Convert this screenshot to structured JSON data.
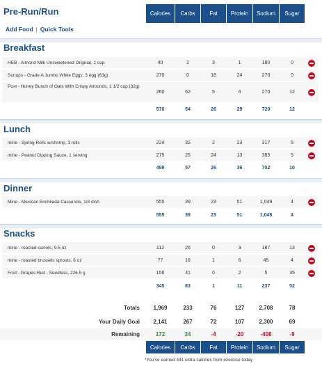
{
  "columns": [
    "Calories",
    "Carbs",
    "Fat",
    "Protein",
    "Sodium",
    "Sugar"
  ],
  "links": {
    "add_food": "Add Food",
    "quick_tools": "Quick Tools",
    "separator": "|"
  },
  "meals": [
    {
      "name": "Pre-Run/Run",
      "items": [],
      "totals": []
    },
    {
      "name": "Breakfast",
      "items": [
        {
          "name": "HEB - Almond Milk Unsweetened Original, 1 cup",
          "values": [
            "40",
            "2",
            "3",
            "1",
            "180",
            "0"
          ]
        },
        {
          "name": "Sunups - Grade A Jumbo White Eggs, 3 egg (63g)",
          "values": [
            "270",
            "0",
            "18",
            "24",
            "270",
            "0"
          ]
        },
        {
          "name": "Post - Honey Bunch of Oats With Crispy Almonds, 1 1/2 cup (32g)",
          "values": [
            "260",
            "52",
            "5",
            "4",
            "270",
            "12"
          ]
        }
      ],
      "totals": [
        "570",
        "54",
        "26",
        "29",
        "720",
        "12"
      ]
    },
    {
      "name": "Lunch",
      "items": [
        {
          "name": "mine - Spring Rolls w/shrimp, 3 rolls",
          "values": [
            "224",
            "32",
            "2",
            "23",
            "317",
            "5"
          ]
        },
        {
          "name": "mine - Peanut Dipping Sauce, 1 serving",
          "values": [
            "275",
            "25",
            "24",
            "13",
            "385",
            "5"
          ]
        }
      ],
      "totals": [
        "499",
        "57",
        "26",
        "36",
        "702",
        "10"
      ]
    },
    {
      "name": "Dinner",
      "items": [
        {
          "name": "Mine - Mexican Enchilada Casserole, 1/8 dish",
          "values": [
            "555",
            "39",
            "23",
            "51",
            "1,049",
            "4"
          ]
        }
      ],
      "totals": [
        "555",
        "39",
        "23",
        "51",
        "1,049",
        "4"
      ]
    },
    {
      "name": "Snacks",
      "items": [
        {
          "name": "mine - roasted carrots, 9.5 oz",
          "values": [
            "112",
            "26",
            "0",
            "3",
            "187",
            "13"
          ]
        },
        {
          "name": "mine - roasted brussels sprouts, 6 oz",
          "values": [
            "77",
            "16",
            "1",
            "6",
            "45",
            "4"
          ]
        },
        {
          "name": "Fruit - Grapes Red - Seedless, 226.5 g",
          "values": [
            "156",
            "41",
            "0",
            "2",
            "5",
            "35"
          ]
        }
      ],
      "totals": [
        "345",
        "83",
        "1",
        "11",
        "237",
        "52"
      ]
    }
  ],
  "summary": {
    "totals": {
      "label": "Totals",
      "values": [
        "1,969",
        "233",
        "76",
        "127",
        "2,708",
        "78"
      ]
    },
    "goal": {
      "label": "Your Daily Goal",
      "values": [
        "2,141",
        "267",
        "72",
        "107",
        "2,300",
        "69"
      ]
    },
    "remaining": {
      "label": "Remaining",
      "values": [
        "172",
        "34",
        "-4",
        "-20",
        "-408",
        "-9"
      ],
      "status": [
        "positive",
        "positive",
        "negative",
        "negative",
        "negative",
        "negative"
      ]
    }
  },
  "footnote": "*You've earned 441 extra calories from exercise today",
  "colors": {
    "header_bg": "#1b4f8a",
    "accent": "#1b4f8a",
    "positive": "#2e8a2e",
    "negative": "#d0021b"
  }
}
